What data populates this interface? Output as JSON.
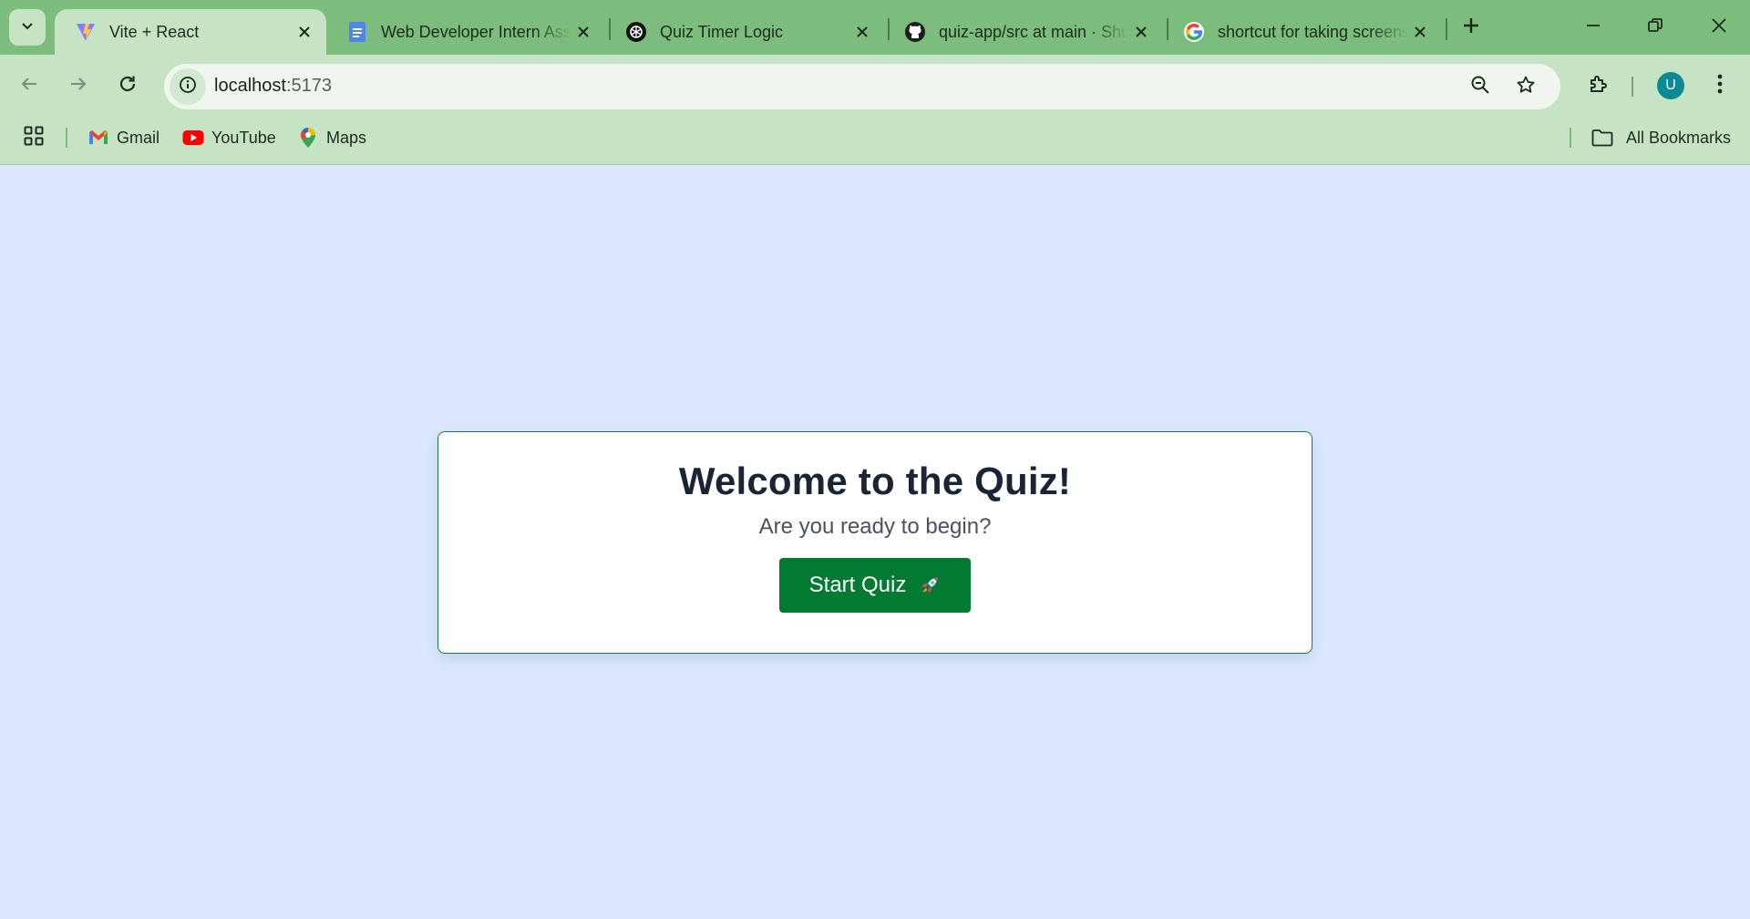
{
  "browser": {
    "tabs": [
      {
        "title": "Vite + React",
        "icon": "vite-icon",
        "active": true
      },
      {
        "title": "Web Developer Intern Assignment",
        "icon": "google-docs-icon",
        "active": false
      },
      {
        "title": "Quiz Timer Logic",
        "icon": "chatgpt-icon",
        "active": false
      },
      {
        "title": "quiz-app/src at main · Shubham",
        "icon": "github-icon",
        "active": false
      },
      {
        "title": "shortcut for taking screenshot",
        "icon": "google-icon",
        "active": false
      }
    ],
    "url_host": "localhost",
    "url_port": ":5173",
    "avatar_letter": "U",
    "bookmarks": [
      {
        "label": "Gmail",
        "icon": "gmail-icon"
      },
      {
        "label": "YouTube",
        "icon": "youtube-icon"
      },
      {
        "label": "Maps",
        "icon": "maps-icon"
      }
    ],
    "all_bookmarks_label": "All Bookmarks"
  },
  "quiz": {
    "title": "Welcome to the Quiz!",
    "subtitle": "Are you ready to begin?",
    "start_label": "Start Quiz",
    "start_icon": "rocket-icon"
  },
  "colors": {
    "tabstrip": "#7cbc7c",
    "toolbar": "#c6e3c4",
    "page_bg": "#dbe8fc",
    "button": "#037a32",
    "card_border": "#1e7a3e"
  }
}
